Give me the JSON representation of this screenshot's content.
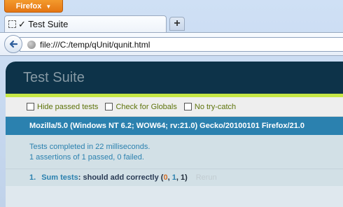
{
  "browser": {
    "menu_button_label": "Firefox",
    "tab_title": "✓ Test Suite",
    "new_tab_label": "+",
    "address": "file:///C:/temp/qUnit/qunit.html"
  },
  "qunit": {
    "header": "Test Suite",
    "toolbar": {
      "hide_passed": "Hide passed tests",
      "check_globals": "Check for Globals",
      "no_try_catch": "No try-catch"
    },
    "user_agent": "Mozilla/5.0 (Windows NT 6.2; WOW64; rv:21.0) Gecko/20100101 Firefox/21.0",
    "result": {
      "line1": "Tests completed in 22 milliseconds.",
      "line2": "1 assertions of 1 passed, 0 failed."
    },
    "tests": [
      {
        "number": "1.",
        "module": "Sum tests",
        "separator": ":",
        "name": "should add correctly",
        "count_open": "(",
        "failed": "0",
        "comma1": ", ",
        "passed": "1",
        "comma2": ", ",
        "total": "1",
        "count_close": ")",
        "rerun": "Rerun"
      }
    ]
  },
  "colors": {
    "accent_orange": "#e57613",
    "qunit_header": "#0d3349",
    "qunit_banner": "#c6e746",
    "qunit_blue": "#2b81af"
  }
}
